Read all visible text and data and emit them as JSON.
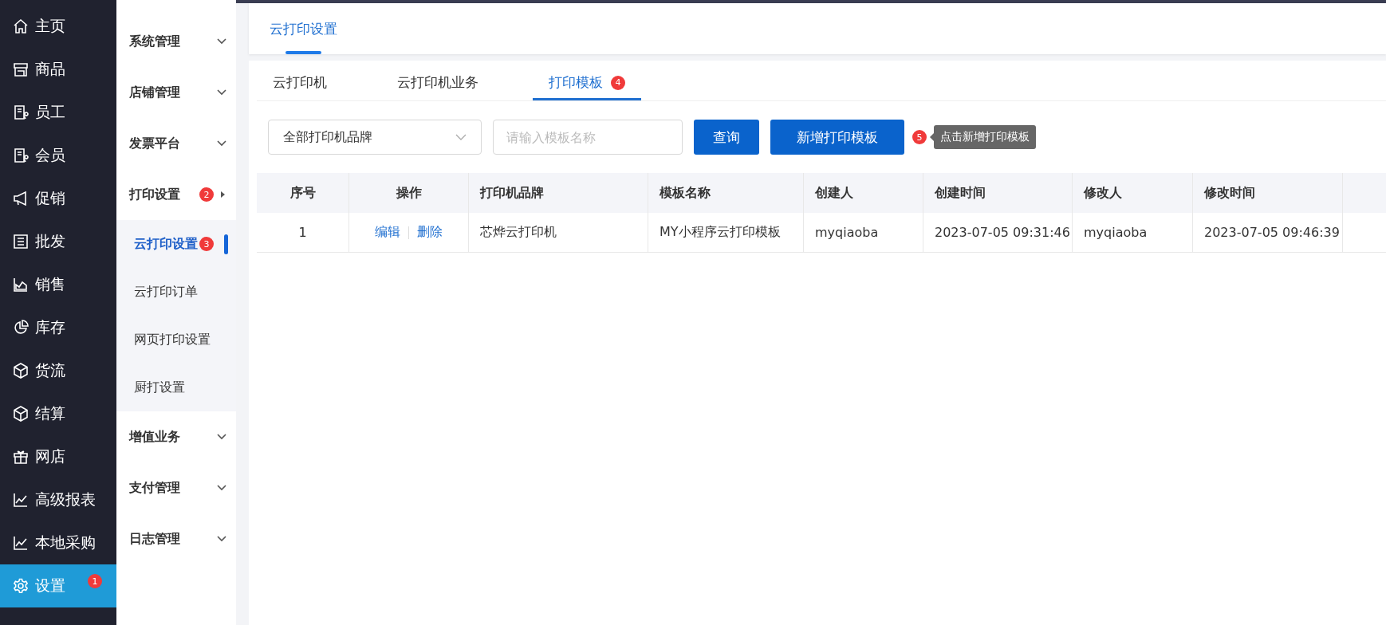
{
  "nav": [
    {
      "label": "主页",
      "selected": false
    },
    {
      "label": "商品",
      "selected": false
    },
    {
      "label": "员工",
      "selected": false
    },
    {
      "label": "会员",
      "selected": false
    },
    {
      "label": "促销",
      "selected": false
    },
    {
      "label": "批发",
      "selected": false
    },
    {
      "label": "销售",
      "selected": false
    },
    {
      "label": "库存",
      "selected": false
    },
    {
      "label": "货流",
      "selected": false
    },
    {
      "label": "结算",
      "selected": false
    },
    {
      "label": "网店",
      "selected": false
    },
    {
      "label": "高级报表",
      "selected": false
    },
    {
      "label": "本地采购",
      "selected": false
    },
    {
      "label": "设置",
      "selected": true,
      "badge": "1"
    }
  ],
  "submenu": [
    {
      "label": "系统管理",
      "expanded": false
    },
    {
      "label": "店铺管理",
      "expanded": false
    },
    {
      "label": "发票平台",
      "expanded": false
    },
    {
      "label": "打印设置",
      "expanded": true,
      "badge": "2",
      "children": [
        {
          "label": "云打印设置",
          "selected": true,
          "badge": "3"
        },
        {
          "label": "云打印订单",
          "selected": false
        },
        {
          "label": "网页打印设置",
          "selected": false
        },
        {
          "label": "厨打设置",
          "selected": false
        }
      ]
    },
    {
      "label": "增值业务",
      "expanded": false
    },
    {
      "label": "支付管理",
      "expanded": false
    },
    {
      "label": "日志管理",
      "expanded": false
    }
  ],
  "page_tabs": [
    {
      "label": "云打印设置",
      "selected": true
    }
  ],
  "tabs": [
    {
      "label": "云打印机",
      "selected": false
    },
    {
      "label": "云打印机业务",
      "selected": false
    },
    {
      "label": "打印模板",
      "selected": true,
      "badge": "4"
    }
  ],
  "toolbar": {
    "brand_select": "全部打印机品牌",
    "search": {
      "placeholder": "请输入模板名称"
    },
    "query_button": "查询",
    "add_button": "新增打印模板",
    "badge": "5",
    "tooltip": "点击新增打印模板"
  },
  "table": {
    "columns": [
      "序号",
      "操作",
      "打印机品牌",
      "模板名称",
      "创建人",
      "创建时间",
      "修改人",
      "修改时间"
    ],
    "rows": [
      {
        "index": "1",
        "actions": [
          "编辑",
          "删除"
        ],
        "brand": "芯烨云打印机",
        "name": "MY小程序云打印模板",
        "creator": "myqiaoba",
        "created": "2023-07-05 09:31:46",
        "modifier": "myqiaoba",
        "modified": "2023-07-05 09:46:39"
      }
    ]
  }
}
